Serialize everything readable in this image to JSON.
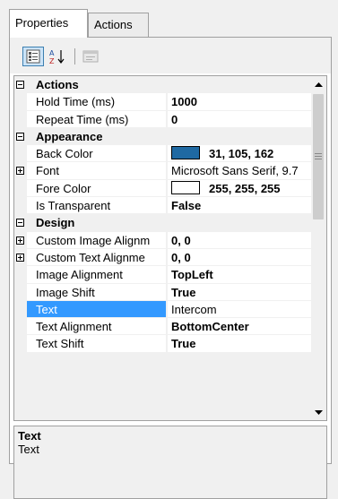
{
  "tabs": [
    {
      "label": "Properties",
      "active": true
    },
    {
      "label": "Actions",
      "active": false
    }
  ],
  "toolbar": {
    "buttons": [
      {
        "icon": "categorized-icon",
        "pressed": true
      },
      {
        "icon": "sort-alphabetical-icon",
        "pressed": false
      },
      {
        "icon": "property-pages-icon",
        "pressed": false
      }
    ]
  },
  "grid": {
    "rows": [
      {
        "type": "category",
        "label": "Actions",
        "expander": "minus"
      },
      {
        "type": "prop",
        "name": "Hold Time (ms)",
        "value": "1000",
        "bold": true
      },
      {
        "type": "prop",
        "name": "Repeat Time (ms)",
        "value": "0",
        "bold": true
      },
      {
        "type": "category",
        "label": "Appearance",
        "expander": "minus"
      },
      {
        "type": "prop",
        "name": "Back Color",
        "value": "31, 105, 162",
        "bold": true,
        "swatch": "#1f69a2"
      },
      {
        "type": "prop",
        "name": "Font",
        "value": "Microsoft Sans Serif, 9.7",
        "bold": false,
        "expander": "plus"
      },
      {
        "type": "prop",
        "name": "Fore Color",
        "value": "255, 255, 255",
        "bold": true,
        "swatch": "#ffffff"
      },
      {
        "type": "prop",
        "name": "Is Transparent",
        "value": "False",
        "bold": true
      },
      {
        "type": "category",
        "label": "Design",
        "expander": "minus"
      },
      {
        "type": "prop",
        "name": "Custom Image Alignm",
        "value": "0, 0",
        "bold": true,
        "expander": "plus"
      },
      {
        "type": "prop",
        "name": "Custom Text Alignme",
        "value": "0, 0",
        "bold": true,
        "expander": "plus"
      },
      {
        "type": "prop",
        "name": "Image Alignment",
        "value": "TopLeft",
        "bold": true
      },
      {
        "type": "prop",
        "name": "Image Shift",
        "value": "True",
        "bold": true
      },
      {
        "type": "prop",
        "name": "Text",
        "value": "Intercom",
        "bold": false,
        "selected": true
      },
      {
        "type": "prop",
        "name": "Text Alignment",
        "value": "BottomCenter",
        "bold": true
      },
      {
        "type": "prop",
        "name": "Text Shift",
        "value": "True",
        "bold": true
      }
    ]
  },
  "help": {
    "title": "Text",
    "description": "Text"
  },
  "colors": {
    "selection": "#3399ff",
    "back_color_swatch": "#1f69a2"
  }
}
